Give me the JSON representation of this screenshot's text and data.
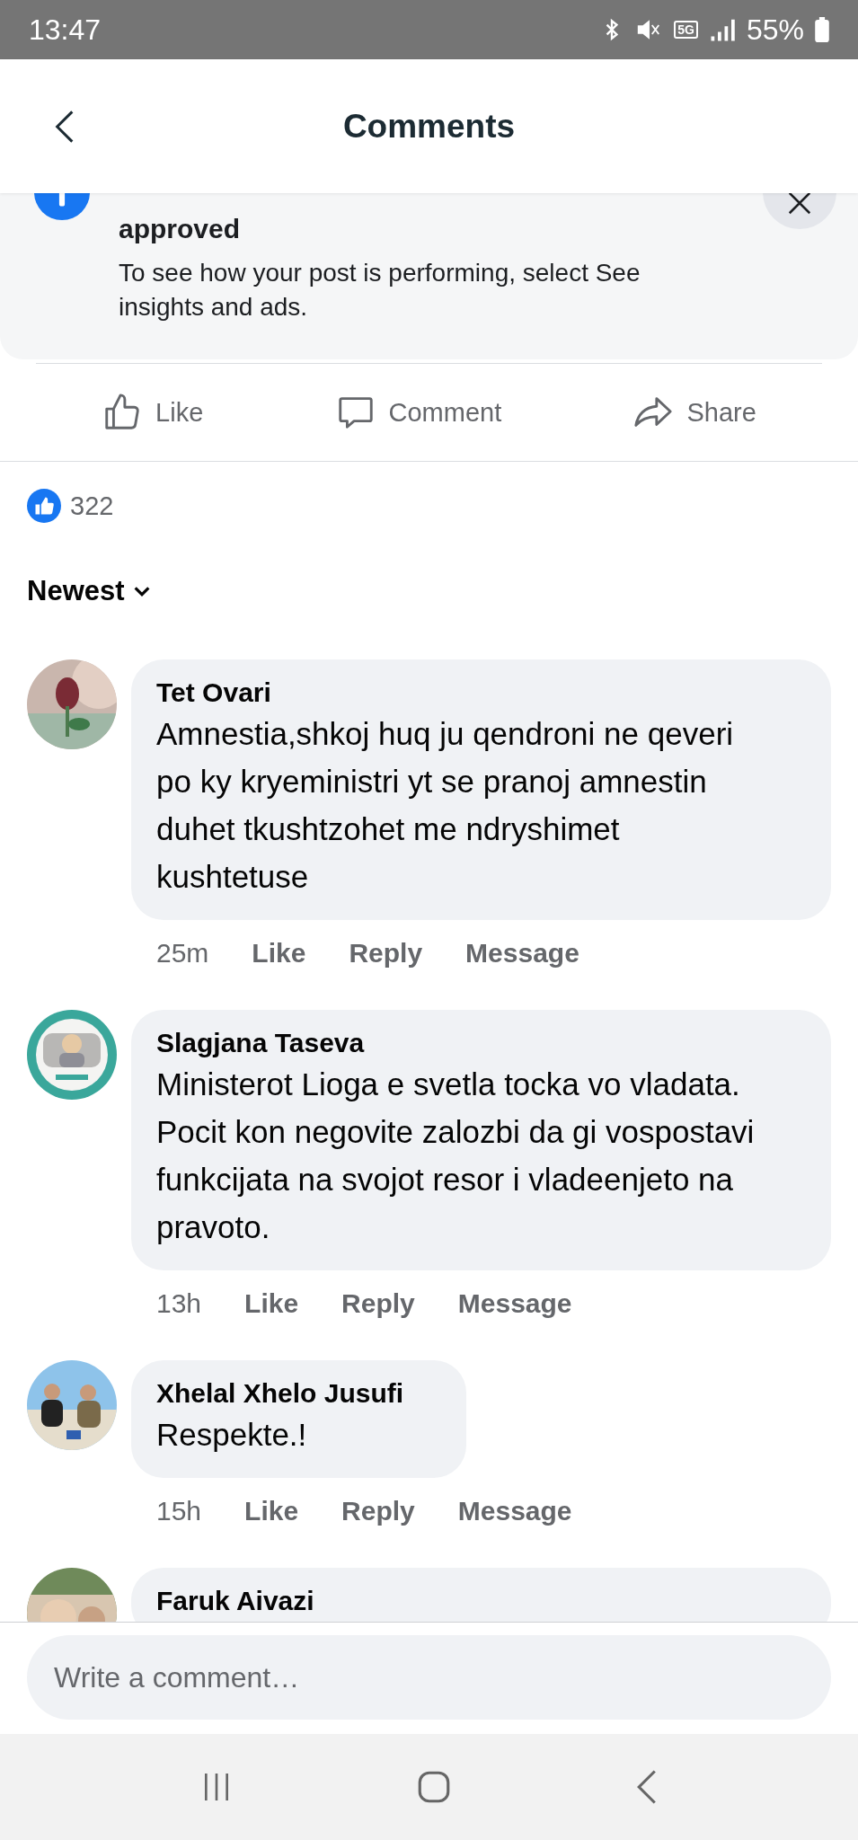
{
  "status_bar": {
    "time": "13:47",
    "network": "5G",
    "battery": "55%"
  },
  "header": {
    "title": "Comments"
  },
  "notice": {
    "title": "approved",
    "body": "To see how your post is performing, select See insights and ads."
  },
  "actions": [
    {
      "label": "Like",
      "kind": "like"
    },
    {
      "label": "Comment",
      "kind": "comment"
    },
    {
      "label": "Share",
      "kind": "share"
    }
  ],
  "reactions": {
    "count": "322"
  },
  "sort": {
    "label": "Newest"
  },
  "comments": [
    {
      "author": "Tet Ovari",
      "text": "Amnestia,shkoj huq ju qendroni ne qeveri po ky kryeministri yt se pranoj amnestin duhet tkushtzohet me ndryshimet kushtetuse",
      "time": "25m",
      "links": [
        "Like",
        "Reply",
        "Message"
      ]
    },
    {
      "author": "Slagjana Taseva",
      "text": "Ministerot Lioga e svetla tocka vo vladata. Pocit kon negovite zalozbi da gi vospostavi funkcijata na svojot resor i vladeenjeto na pravoto.",
      "time": "13h",
      "links": [
        "Like",
        "Reply",
        "Message"
      ]
    },
    {
      "author": "Xhelal Xhelo Jusufi",
      "text": "Respekte.!",
      "time": "15h",
      "links": [
        "Like",
        "Reply",
        "Message"
      ]
    },
    {
      "author": "Faruk Aivazi"
    }
  ],
  "composer": {
    "placeholder": "Write a comment…"
  }
}
